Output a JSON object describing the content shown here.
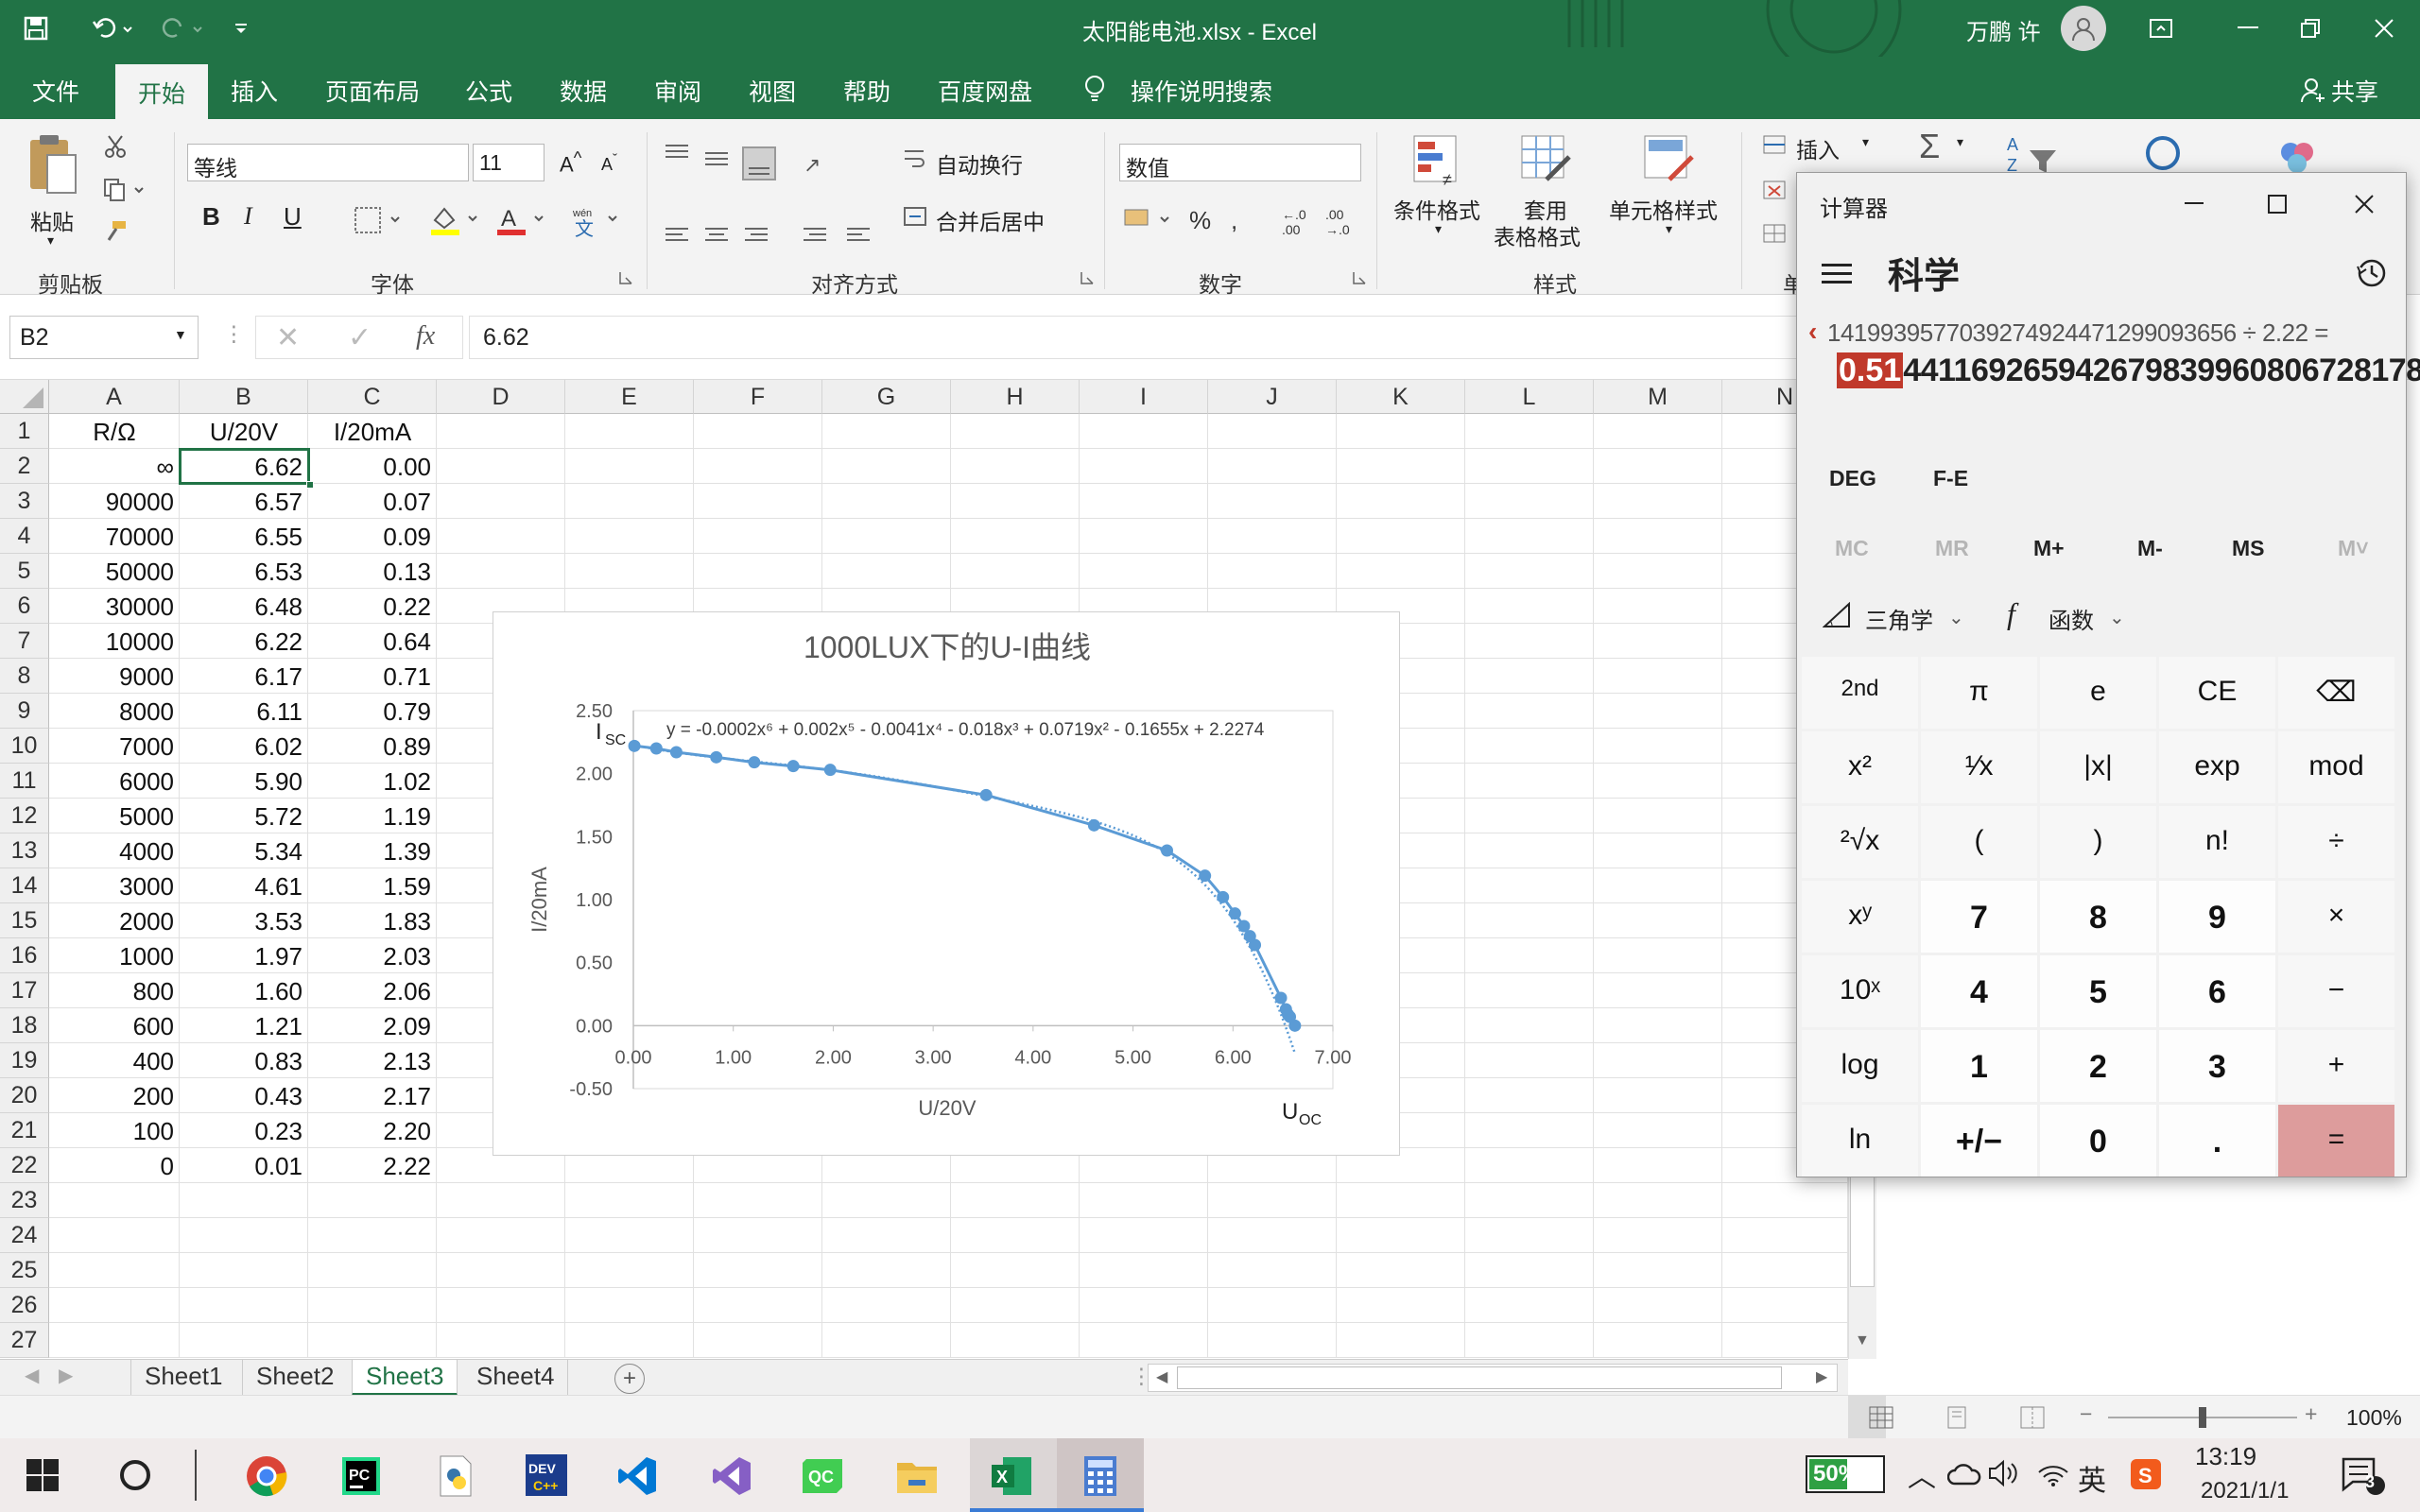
{
  "window": {
    "title": "太阳能电池.xlsx  -  Excel",
    "user": "万鹏 许"
  },
  "menu": [
    "文件",
    "开始",
    "插入",
    "页面布局",
    "公式",
    "数据",
    "审阅",
    "视图",
    "帮助",
    "百度网盘",
    "操作说明搜索",
    "共享"
  ],
  "ribbon": {
    "paste": "粘贴",
    "clipboard": "剪贴板",
    "font_name": "等线",
    "font_size": "11",
    "font_group": "字体",
    "bold": "B",
    "italic": "I",
    "underline": "U",
    "wrap_text": "自动换行",
    "merge_center": "合并后居中",
    "align_group": "对齐方式",
    "number_format": "数值",
    "number_group": "数字",
    "cond_format": "条件格式",
    "table_format_1": "套用",
    "table_format_2": "表格格式",
    "cell_style": "单元格样式",
    "style_group": "样式",
    "insert": "插入",
    "cells_group_partial": "单"
  },
  "formula_bar": {
    "name_box": "B2",
    "fx": "fx",
    "value": "6.62"
  },
  "columns": [
    "A",
    "B",
    "C",
    "D",
    "E",
    "F",
    "G",
    "H",
    "I",
    "J",
    "K",
    "L",
    "M",
    "N"
  ],
  "rows": [
    [
      "R/Ω",
      "U/20V",
      "I/20mA"
    ],
    [
      "∞",
      "6.62",
      "0.00"
    ],
    [
      "90000",
      "6.57",
      "0.07"
    ],
    [
      "70000",
      "6.55",
      "0.09"
    ],
    [
      "50000",
      "6.53",
      "0.13"
    ],
    [
      "30000",
      "6.48",
      "0.22"
    ],
    [
      "10000",
      "6.22",
      "0.64"
    ],
    [
      "9000",
      "6.17",
      "0.71"
    ],
    [
      "8000",
      "6.11",
      "0.79"
    ],
    [
      "7000",
      "6.02",
      "0.89"
    ],
    [
      "6000",
      "5.90",
      "1.02"
    ],
    [
      "5000",
      "5.72",
      "1.19"
    ],
    [
      "4000",
      "5.34",
      "1.39"
    ],
    [
      "3000",
      "4.61",
      "1.59"
    ],
    [
      "2000",
      "3.53",
      "1.83"
    ],
    [
      "1000",
      "1.97",
      "2.03"
    ],
    [
      "800",
      "1.60",
      "2.06"
    ],
    [
      "600",
      "1.21",
      "2.09"
    ],
    [
      "400",
      "0.83",
      "2.13"
    ],
    [
      "200",
      "0.43",
      "2.17"
    ],
    [
      "100",
      "0.23",
      "2.20"
    ],
    [
      "0",
      "0.01",
      "2.22"
    ],
    [],
    [],
    [],
    [],
    []
  ],
  "sheets": [
    "Sheet1",
    "Sheet2",
    "Sheet3",
    "Sheet4"
  ],
  "active_sheet": "Sheet3",
  "status": {
    "zoom": "100%"
  },
  "chart_data": {
    "type": "scatter",
    "title": "1000LUX下的U-I曲线",
    "xlabel": "U/20V",
    "ylabel": "I/20mA",
    "trendline_label": "y = -0.0002x⁶ + 0.002x⁵ - 0.0041x⁴ - 0.018x³ + 0.0719x² - 0.1655x + 2.2274",
    "isc_label": "I",
    "isc_sub": "SC",
    "uoc_label": "U",
    "uoc_sub": "OC",
    "xlim": [
      0,
      7
    ],
    "ylim": [
      -0.5,
      2.5
    ],
    "x_ticks": [
      "0.00",
      "1.00",
      "2.00",
      "3.00",
      "4.00",
      "5.00",
      "6.00",
      "7.00"
    ],
    "y_ticks": [
      "2.50",
      "2.00",
      "1.50",
      "1.00",
      "0.50",
      "0.00",
      "-0.50"
    ],
    "x": [
      6.62,
      6.57,
      6.55,
      6.53,
      6.48,
      6.22,
      6.17,
      6.11,
      6.02,
      5.9,
      5.72,
      5.34,
      4.61,
      3.53,
      1.97,
      1.6,
      1.21,
      0.83,
      0.43,
      0.23,
      0.01
    ],
    "y": [
      0.0,
      0.07,
      0.09,
      0.13,
      0.22,
      0.64,
      0.71,
      0.79,
      0.89,
      1.02,
      1.19,
      1.39,
      1.59,
      1.83,
      2.03,
      2.06,
      2.09,
      2.13,
      2.17,
      2.2,
      2.22
    ],
    "color": "#5b9bd5"
  },
  "calculator": {
    "title": "计算器",
    "mode": "科学",
    "expression": "141993957703927492447129909365​6 ÷ 2.22 =",
    "result_selected": "0.51",
    "result_rest": "44116926594267983996080672817​8",
    "deg": "DEG",
    "fe": "F-E",
    "memory": [
      "MC",
      "MR",
      "M+",
      "M-",
      "MS",
      "M˅"
    ],
    "trig": "三角学",
    "func": "函数",
    "keys": [
      [
        "2nd",
        "π",
        "e",
        "CE",
        "⌫"
      ],
      [
        "x²",
        "¹∕x",
        "|x|",
        "exp",
        "mod"
      ],
      [
        "²√x",
        "(",
        ")",
        "n!",
        "÷"
      ],
      [
        "xʸ",
        "7",
        "8",
        "9",
        "×"
      ],
      [
        "10ˣ",
        "4",
        "5",
        "6",
        "−"
      ],
      [
        "log",
        "1",
        "2",
        "3",
        "+"
      ],
      [
        "ln",
        "+/−",
        "0",
        ".",
        "="
      ]
    ]
  },
  "taskbar": {
    "battery": "50%",
    "ime": "英",
    "time": "13:19",
    "date": "2021/1/1",
    "notifications": "3"
  }
}
